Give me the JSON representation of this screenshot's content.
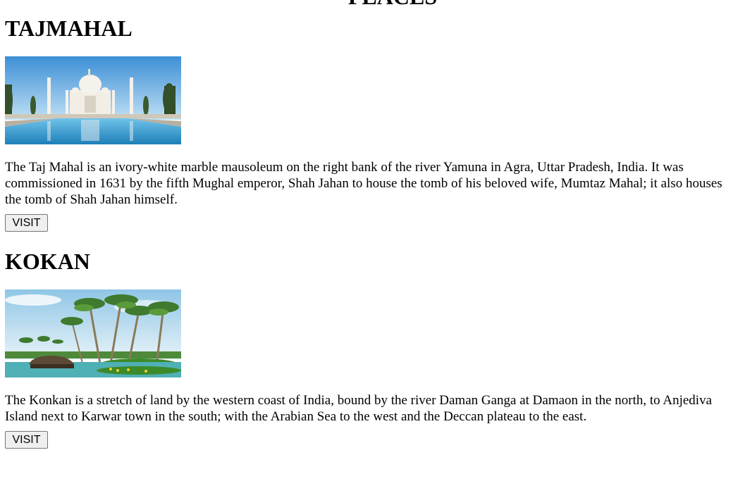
{
  "page": {
    "title": "PLACES"
  },
  "places": [
    {
      "name": "TAJMAHAL",
      "image_icon": "taj-mahal-photo",
      "description": "The Taj Mahal is an ivory-white marble mausoleum on the right bank of the river Yamuna in Agra, Uttar Pradesh, India. It was commissioned in 1631 by the fifth Mughal emperor, Shah Jahan to house the tomb of his beloved wife, Mumtaz Mahal; it also houses the tomb of Shah Jahan himself.",
      "button_label": "VISIT"
    },
    {
      "name": "KOKAN",
      "image_icon": "konkan-beach-photo",
      "description": "The Konkan is a stretch of land by the western coast of India, bound by the river Daman Ganga at Damaon in the north, to Anjediva Island next to Karwar town in the south; with the Arabian Sea to the west and the Deccan plateau to the east.",
      "button_label": "VISIT"
    }
  ],
  "colors": {
    "button_bg": "#efefef",
    "button_border": "#767676",
    "text": "#000000"
  }
}
